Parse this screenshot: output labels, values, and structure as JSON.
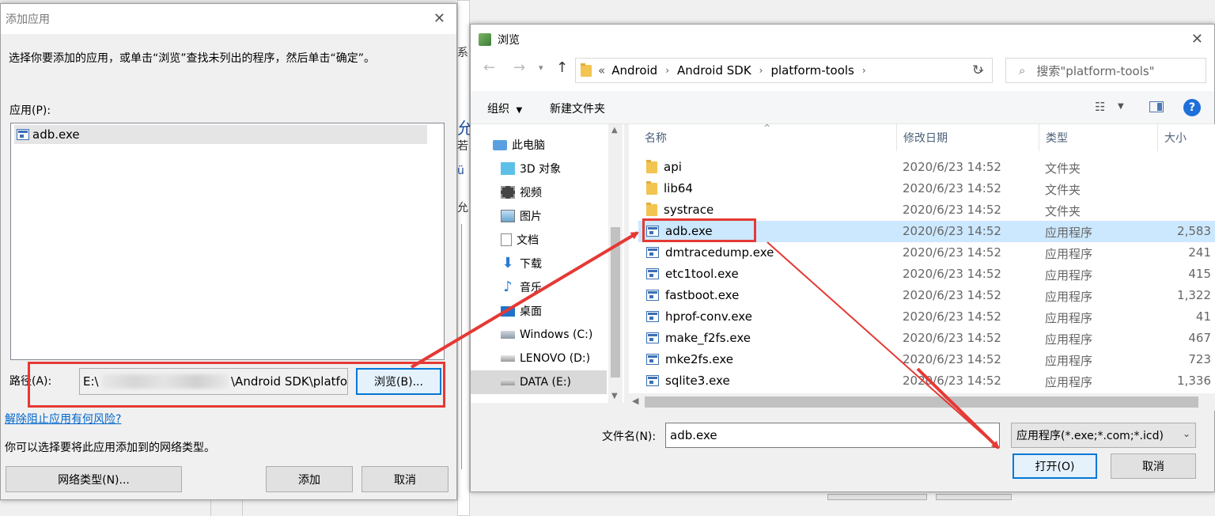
{
  "add_app": {
    "title": "添加应用",
    "instruction": "选择你要添加的应用，或单击“浏览”查找未列出的程序，然后单击“确定”。",
    "apps_label": "应用(P):",
    "apps": [
      "adb.exe"
    ],
    "path_label": "路径(A):",
    "path_value_start": "E:\\",
    "path_value_end": "\\Android SDK\\platfo",
    "browse_button": "浏览(B)...",
    "risk_link": "解除阻止应用有何风险?",
    "network_text": "你可以选择要将此应用添加到的网络类型。",
    "network_button": "网络类型(N)...",
    "add_button": "添加",
    "cancel_button": "取消"
  },
  "browse": {
    "title": "浏览",
    "breadcrumb": [
      "Android",
      "Android SDK",
      "platform-tools"
    ],
    "search_placeholder": "搜索\"platform-tools\"",
    "organize": "组织",
    "new_folder": "新建文件夹",
    "nav": [
      "此电脑",
      "3D 对象",
      "视频",
      "图片",
      "文档",
      "下载",
      "音乐",
      "桌面",
      "Windows (C:)",
      "LENOVO (D:)",
      "DATA (E:)"
    ],
    "columns": {
      "name": "名称",
      "date": "修改日期",
      "type": "类型",
      "size": "大小"
    },
    "files": [
      {
        "name": "api",
        "date": "2020/6/23 14:52",
        "type": "文件夹",
        "size": "",
        "kind": "folder"
      },
      {
        "name": "lib64",
        "date": "2020/6/23 14:52",
        "type": "文件夹",
        "size": "",
        "kind": "folder"
      },
      {
        "name": "systrace",
        "date": "2020/6/23 14:52",
        "type": "文件夹",
        "size": "",
        "kind": "folder"
      },
      {
        "name": "adb.exe",
        "date": "2020/6/23 14:52",
        "type": "应用程序",
        "size": "2,583",
        "kind": "exe"
      },
      {
        "name": "dmtracedump.exe",
        "date": "2020/6/23 14:52",
        "type": "应用程序",
        "size": "241",
        "kind": "exe"
      },
      {
        "name": "etc1tool.exe",
        "date": "2020/6/23 14:52",
        "type": "应用程序",
        "size": "415",
        "kind": "exe"
      },
      {
        "name": "fastboot.exe",
        "date": "2020/6/23 14:52",
        "type": "应用程序",
        "size": "1,322",
        "kind": "exe"
      },
      {
        "name": "hprof-conv.exe",
        "date": "2020/6/23 14:52",
        "type": "应用程序",
        "size": "41",
        "kind": "exe"
      },
      {
        "name": "make_f2fs.exe",
        "date": "2020/6/23 14:52",
        "type": "应用程序",
        "size": "467",
        "kind": "exe"
      },
      {
        "name": "mke2fs.exe",
        "date": "2020/6/23 14:52",
        "type": "应用程序",
        "size": "723",
        "kind": "exe"
      },
      {
        "name": "sqlite3.exe",
        "date": "2020/6/23 14:52",
        "type": "应用程序",
        "size": "1,336",
        "kind": "exe"
      }
    ],
    "filename_label": "文件名(N):",
    "filename_value": "adb.exe",
    "filter": "应用程序(*.exe;*.com;*.icd)",
    "open_button": "打开(O)",
    "cancel_button": "取消"
  },
  "colors": {
    "annotation_red": "#e53935",
    "selection": "#cce8ff",
    "link": "#0066cc"
  }
}
